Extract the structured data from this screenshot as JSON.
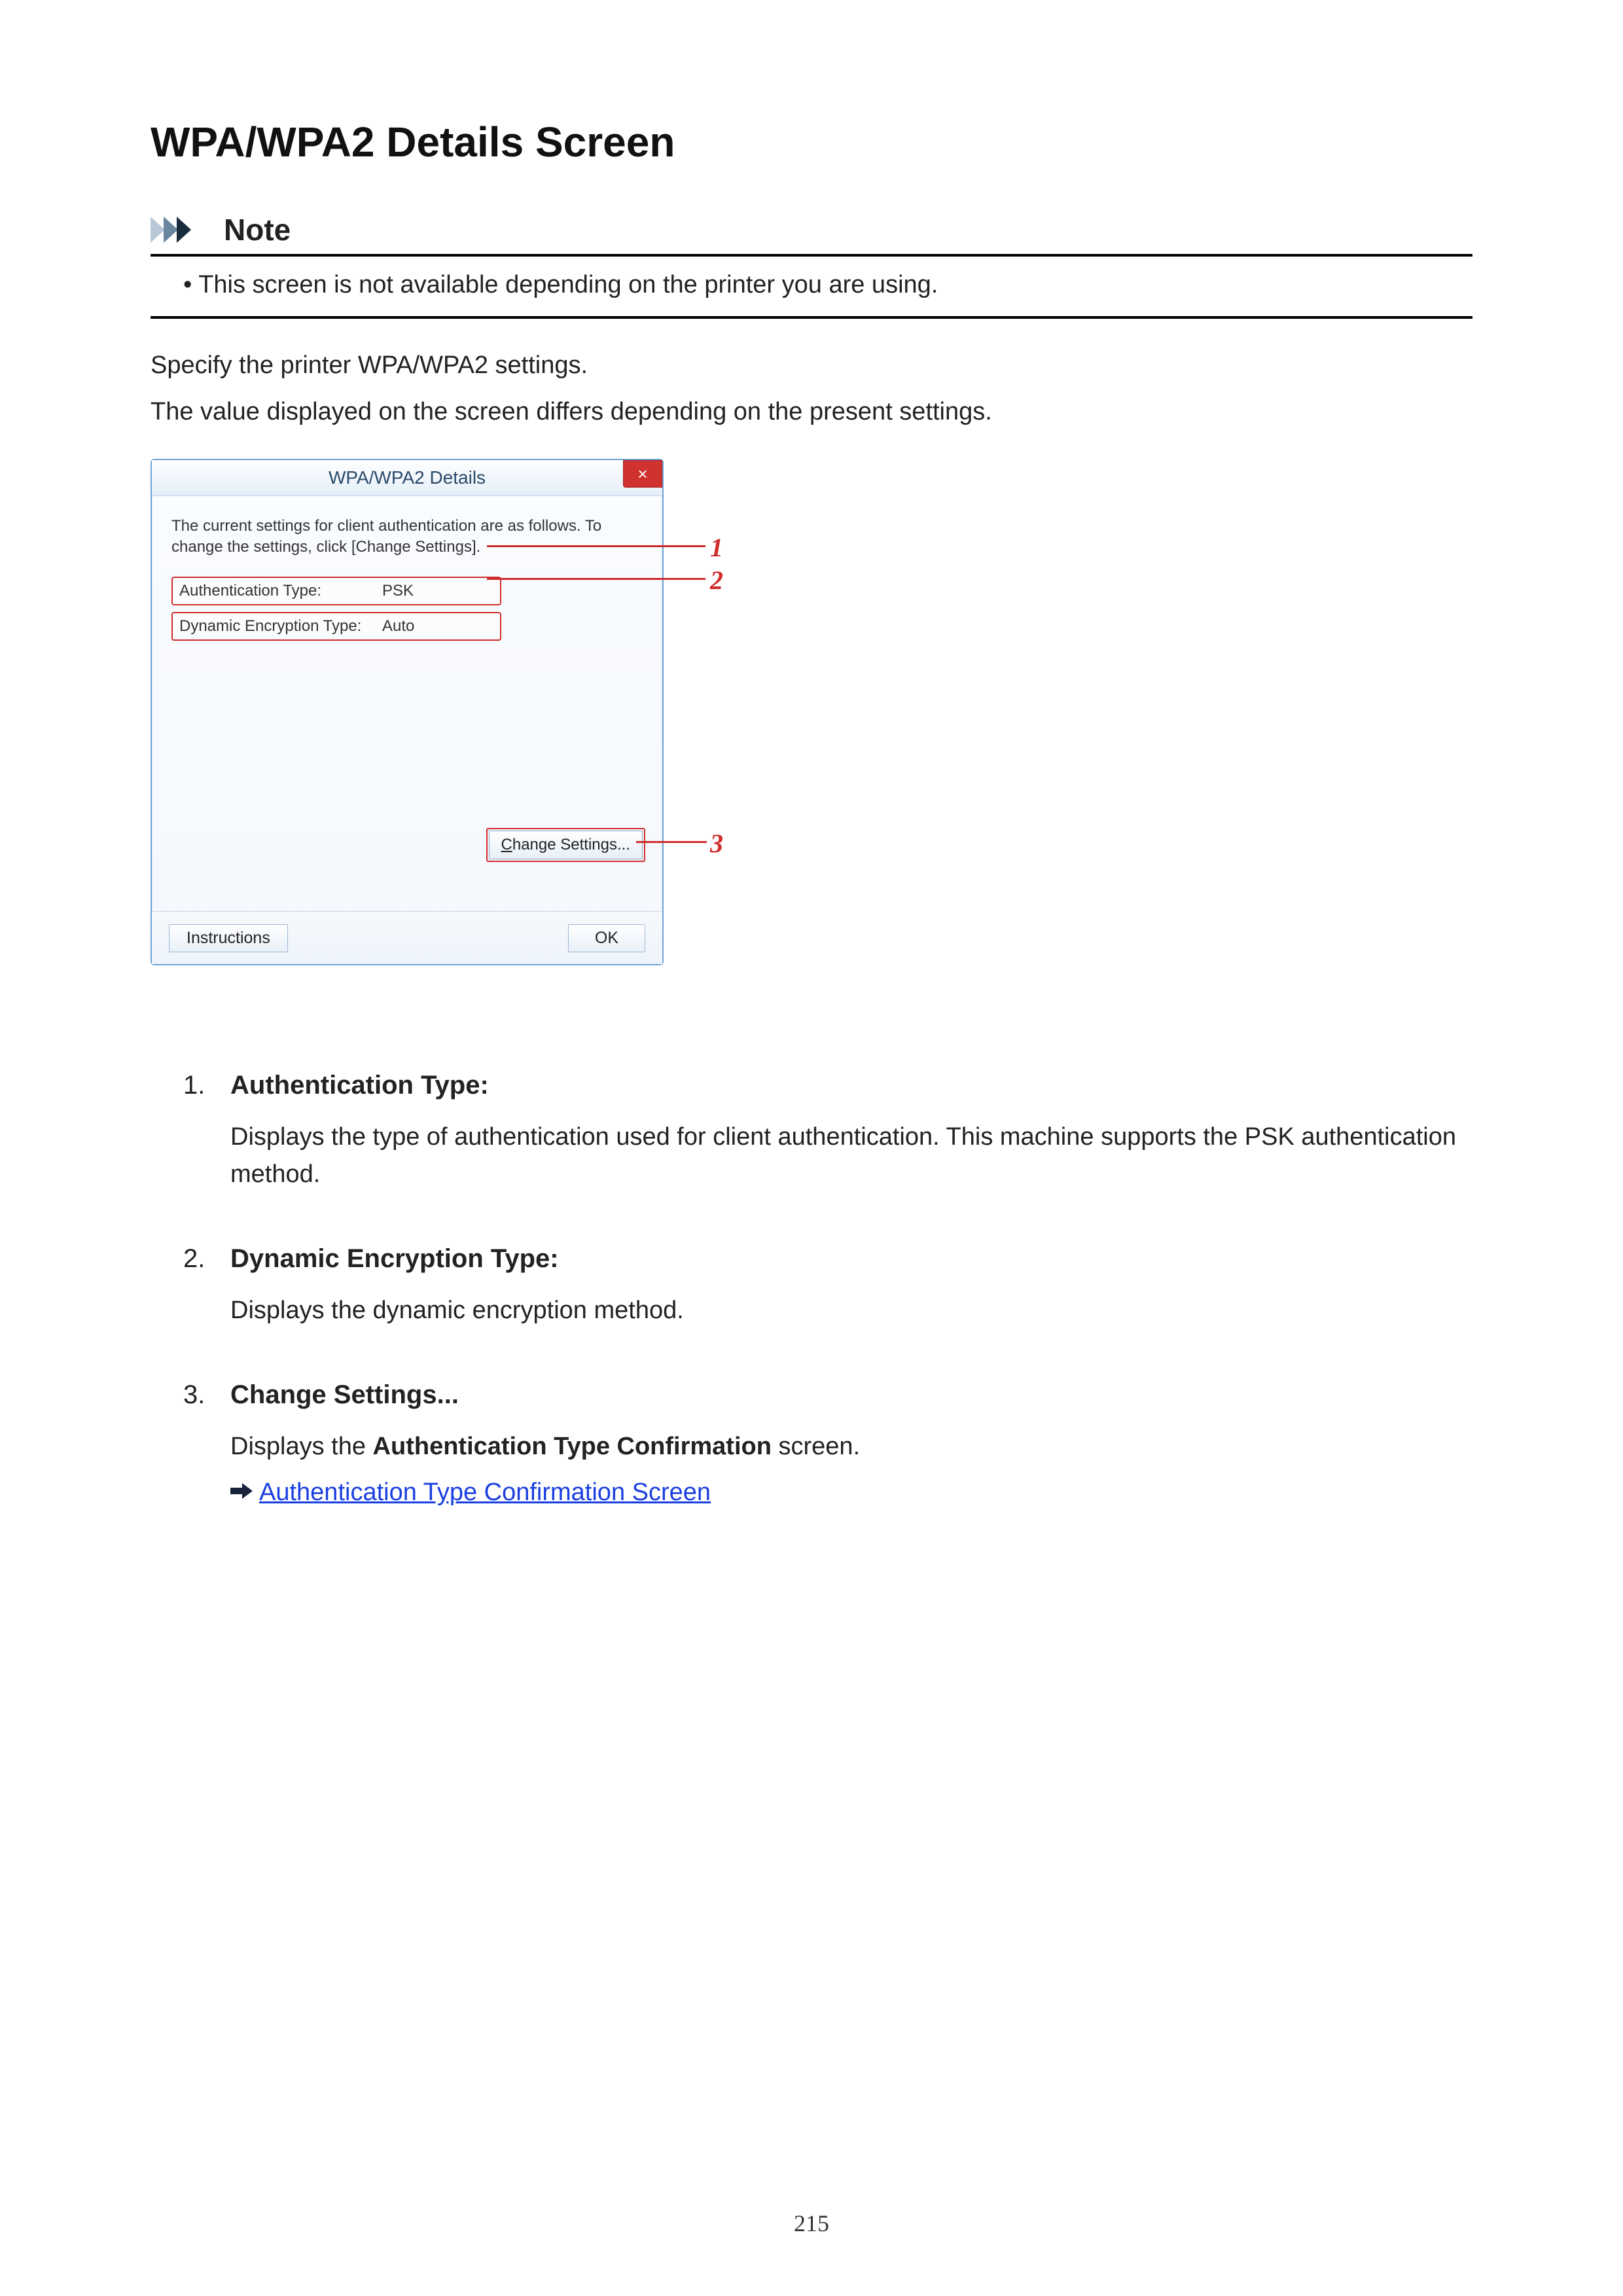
{
  "page_title": "WPA/WPA2 Details Screen",
  "note": {
    "heading": "Note",
    "text": "This screen is not available depending on the printer you are using."
  },
  "intro": {
    "p1": "Specify the printer WPA/WPA2 settings.",
    "p2": "The value displayed on the screen differs depending on the present settings."
  },
  "dialog": {
    "title": "WPA/WPA2 Details",
    "close_label": "×",
    "instructions": "The current settings for client authentication are as follows. To change the settings, click [Change Settings].",
    "auth_label": "Authentication Type:",
    "auth_value": "PSK",
    "enc_label": "Dynamic Encryption Type:",
    "enc_value": "Auto",
    "change_btn_prefix": "C",
    "change_btn_rest": "hange Settings...",
    "instructions_btn": "Instructions",
    "ok_btn": "OK"
  },
  "callouts": {
    "n1": "1",
    "n2": "2",
    "n3": "3"
  },
  "items": [
    {
      "title": "Authentication Type:",
      "body": "Displays the type of authentication used for client authentication. This machine supports the PSK authentication method."
    },
    {
      "title": "Dynamic Encryption Type:",
      "body": "Displays the dynamic encryption method."
    },
    {
      "title": "Change Settings...",
      "body_prefix": "Displays the ",
      "body_bold": "Authentication Type Confirmation",
      "body_suffix": " screen.",
      "link": "Authentication Type Confirmation Screen"
    }
  ],
  "page_number": "215"
}
